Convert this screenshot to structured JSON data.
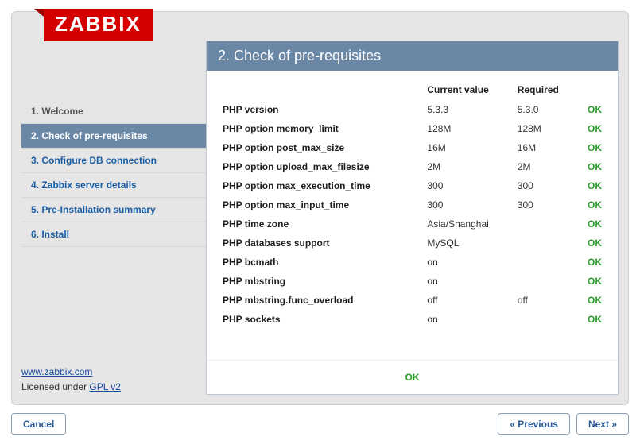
{
  "logo": "ZABBIX",
  "page_title": "2. Check of pre-requisites",
  "nav": [
    {
      "label": "1. Welcome",
      "state": "done"
    },
    {
      "label": "2. Check of pre-requisites",
      "state": "active"
    },
    {
      "label": "3. Configure DB connection",
      "state": "pending"
    },
    {
      "label": "4. Zabbix server details",
      "state": "pending"
    },
    {
      "label": "5. Pre-Installation summary",
      "state": "pending"
    },
    {
      "label": "6. Install",
      "state": "pending"
    }
  ],
  "headers": {
    "current": "Current value",
    "required": "Required"
  },
  "rows": [
    {
      "name": "PHP version",
      "current": "5.3.3",
      "required": "5.3.0",
      "status": "OK"
    },
    {
      "name": "PHP option memory_limit",
      "current": "128M",
      "required": "128M",
      "status": "OK"
    },
    {
      "name": "PHP option post_max_size",
      "current": "16M",
      "required": "16M",
      "status": "OK"
    },
    {
      "name": "PHP option upload_max_filesize",
      "current": "2M",
      "required": "2M",
      "status": "OK"
    },
    {
      "name": "PHP option max_execution_time",
      "current": "300",
      "required": "300",
      "status": "OK"
    },
    {
      "name": "PHP option max_input_time",
      "current": "300",
      "required": "300",
      "status": "OK"
    },
    {
      "name": "PHP time zone",
      "current": "Asia/Shanghai",
      "required": "",
      "status": "OK"
    },
    {
      "name": "PHP databases support",
      "current": "MySQL",
      "required": "",
      "status": "OK"
    },
    {
      "name": "PHP bcmath",
      "current": "on",
      "required": "",
      "status": "OK"
    },
    {
      "name": "PHP mbstring",
      "current": "on",
      "required": "",
      "status": "OK"
    },
    {
      "name": "PHP mbstring.func_overload",
      "current": "off",
      "required": "off",
      "status": "OK"
    },
    {
      "name": "PHP sockets",
      "current": "on",
      "required": "",
      "status": "OK"
    }
  ],
  "overall_status": "OK",
  "footer": {
    "site_link": "www.zabbix.com",
    "license_prefix": "Licensed under ",
    "license_link": "GPL v2"
  },
  "buttons": {
    "cancel": "Cancel",
    "previous": "« Previous",
    "next": "Next »"
  }
}
